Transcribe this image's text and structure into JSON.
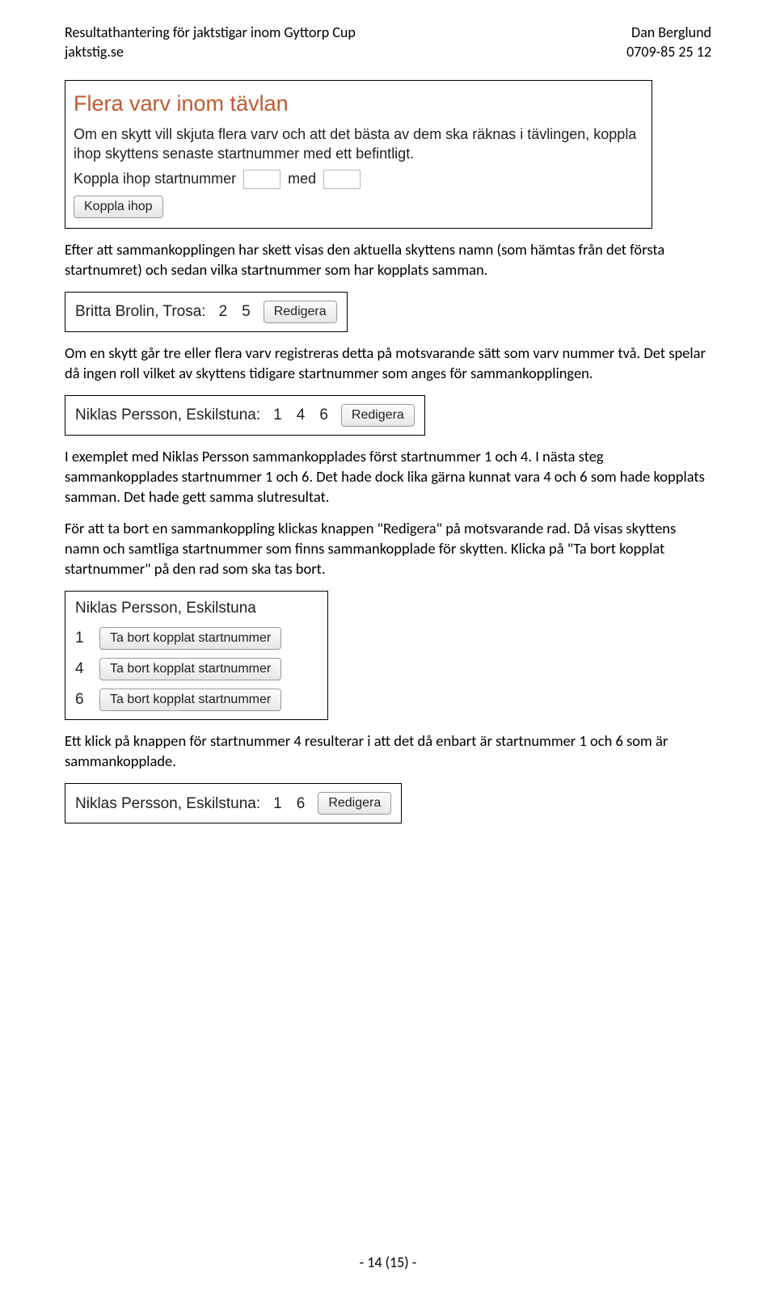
{
  "header": {
    "left1": "Resultathantering för jaktstigar inom Gyttorp Cup",
    "left2": "jaktstig.se",
    "right1": "Dan Berglund",
    "right2": "0709-85 25 12"
  },
  "topbox": {
    "title": "Flera varv inom tävlan",
    "para1": "Om en skytt vill skjuta flera varv och att det bästa av dem ska räknas i tävlingen, koppla ihop skyttens senaste startnummer med ett befintligt.",
    "line_prefix": "Koppla ihop startnummer",
    "line_mid": "med",
    "button": "Koppla ihop"
  },
  "p1": "Efter att sammankopplingen har skett visas den aktuella skyttens namn (som hämtas från det första startnumret) och sedan vilka startnummer som har kopplats samman.",
  "row1": {
    "name": "Britta Brolin, Trosa:",
    "nums": [
      "2",
      "5"
    ],
    "btn": "Redigera"
  },
  "p2": "Om en skytt går tre eller flera varv registreras detta på motsvarande sätt som varv nummer två. Det spelar då ingen roll vilket av skyttens tidigare startnummer som anges för sammankopplingen.",
  "row2": {
    "name": "Niklas Persson, Eskilstuna:",
    "nums": [
      "1",
      "4",
      "6"
    ],
    "btn": "Redigera"
  },
  "p3": "I exemplet med Niklas Persson sammankopplades först startnummer 1 och 4. I nästa steg sammankopplades startnummer 1 och 6. Det hade dock lika gärna kunnat vara 4 och 6 som hade kopplats samman. Det hade gett samma slutresultat.",
  "p4": "För att ta bort en sammankoppling klickas knappen \"Redigera\" på motsvarande rad. Då visas skyttens namn och samtliga startnummer som finns sammankopplade för skytten. Klicka på \"Ta bort kopplat startnummer\" på den rad som ska tas bort.",
  "removebox": {
    "title": "Niklas Persson, Eskilstuna",
    "rows": [
      {
        "n": "1",
        "btn": "Ta bort kopplat startnummer"
      },
      {
        "n": "4",
        "btn": "Ta bort kopplat startnummer"
      },
      {
        "n": "6",
        "btn": "Ta bort kopplat startnummer"
      }
    ]
  },
  "p5": "Ett klick på knappen för startnummer 4 resulterar i att det då enbart är startnummer 1 och 6 som är sammankopplade.",
  "row3": {
    "name": "Niklas Persson, Eskilstuna:",
    "nums": [
      "1",
      "6"
    ],
    "btn": "Redigera"
  },
  "footer": "- 14 (15) -"
}
